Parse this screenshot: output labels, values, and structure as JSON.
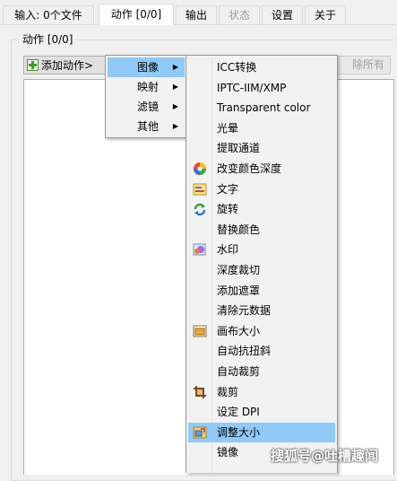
{
  "tabs": [
    {
      "label": "输入: 0个文件",
      "state": "normal"
    },
    {
      "label": "动作 [0/0]",
      "state": "active"
    },
    {
      "label": "输出",
      "state": "normal"
    },
    {
      "label": "状态",
      "state": "disabled"
    },
    {
      "label": "设置",
      "state": "normal"
    },
    {
      "label": "关于",
      "state": "normal"
    }
  ],
  "group": {
    "title": "动作 [0/0]"
  },
  "toolbar": {
    "add_label": "添加动作>",
    "remove_all_label": "除所有"
  },
  "menu_main": [
    {
      "label": "图像",
      "arrow": "▶",
      "highlighted": true
    },
    {
      "label": "映射",
      "arrow": "▶"
    },
    {
      "label": "滤镜",
      "arrow": "▶"
    },
    {
      "label": "其他",
      "arrow": "▶"
    }
  ],
  "menu_image": [
    {
      "label": "ICC转换",
      "icon": ""
    },
    {
      "label": "IPTC-IIM/XMP",
      "icon": ""
    },
    {
      "label": "Transparent color",
      "icon": ""
    },
    {
      "label": "光晕",
      "icon": ""
    },
    {
      "label": "提取通道",
      "icon": ""
    },
    {
      "label": "改变颜色深度",
      "icon": "color-wheel-icon"
    },
    {
      "label": "文字",
      "icon": "text-icon"
    },
    {
      "label": "旋转",
      "icon": "rotate-icon"
    },
    {
      "label": "替换颜色",
      "icon": ""
    },
    {
      "label": "水印",
      "icon": "watermark-icon"
    },
    {
      "label": "深度裁切",
      "icon": ""
    },
    {
      "label": "添加遮罩",
      "icon": ""
    },
    {
      "label": "清除元数据",
      "icon": ""
    },
    {
      "label": "画布大小",
      "icon": "canvas-icon"
    },
    {
      "label": "自动抗扭斜",
      "icon": ""
    },
    {
      "label": "自动裁剪",
      "icon": ""
    },
    {
      "label": "裁剪",
      "icon": "crop-icon"
    },
    {
      "label": "设定 DPI",
      "icon": ""
    },
    {
      "label": "调整大小",
      "icon": "resize-icon",
      "highlighted": true
    },
    {
      "label": "镜像",
      "icon": ""
    }
  ],
  "watermark": {
    "text": "搜狐号@吐槽趣闻"
  },
  "colors": {
    "highlight": "#91c9f7",
    "window_bg": "#f0f0f0",
    "menu_bg": "#f2f2f2"
  }
}
